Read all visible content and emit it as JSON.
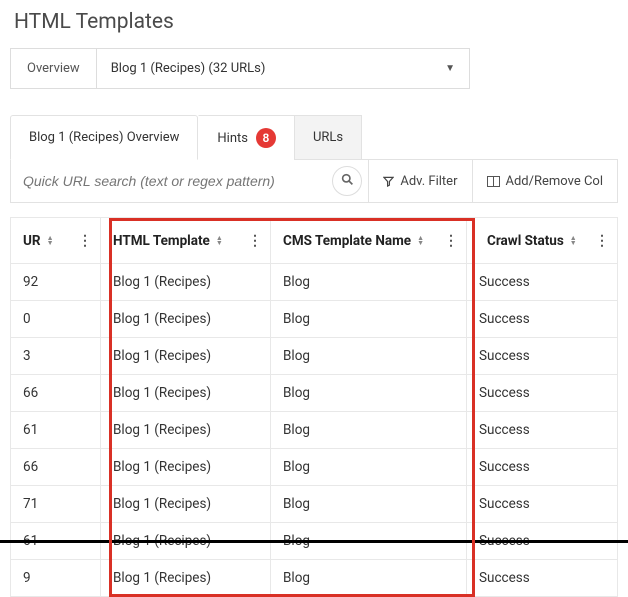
{
  "page_title": "HTML Templates",
  "top": {
    "overview_label": "Overview",
    "selected": "Blog 1 (Recipes) (32 URLs)"
  },
  "tabs": {
    "overview": "Blog 1 (Recipes) Overview",
    "hints": "Hints",
    "hints_badge": "8",
    "urls": "URLs"
  },
  "toolbar": {
    "search_placeholder": "Quick URL search (text or regex pattern)",
    "adv_filter": "Adv. Filter",
    "add_remove_cols": "Add/Remove Col"
  },
  "columns": {
    "ur": "UR",
    "html_template": "HTML Template",
    "cms_template": "CMS Template Name",
    "crawl_status": "Crawl Status"
  },
  "rows": [
    {
      "ur": "92",
      "html_template": "Blog 1 (Recipes)",
      "cms": "Blog",
      "status": "Success"
    },
    {
      "ur": "0",
      "html_template": "Blog 1 (Recipes)",
      "cms": "Blog",
      "status": "Success"
    },
    {
      "ur": "3",
      "html_template": "Blog 1 (Recipes)",
      "cms": "Blog",
      "status": "Success"
    },
    {
      "ur": "66",
      "html_template": "Blog 1 (Recipes)",
      "cms": "Blog",
      "status": "Success"
    },
    {
      "ur": "61",
      "html_template": "Blog 1 (Recipes)",
      "cms": "Blog",
      "status": "Success"
    },
    {
      "ur": "66",
      "html_template": "Blog 1 (Recipes)",
      "cms": "Blog",
      "status": "Success"
    },
    {
      "ur": "71",
      "html_template": "Blog 1 (Recipes)",
      "cms": "Blog",
      "status": "Success"
    },
    {
      "ur": "61",
      "html_template": "Blog 1 (Recipes)",
      "cms": "Blog",
      "status": "Success"
    },
    {
      "ur": "9",
      "html_template": "Blog 1 (Recipes)",
      "cms": "Blog",
      "status": "Success"
    }
  ]
}
